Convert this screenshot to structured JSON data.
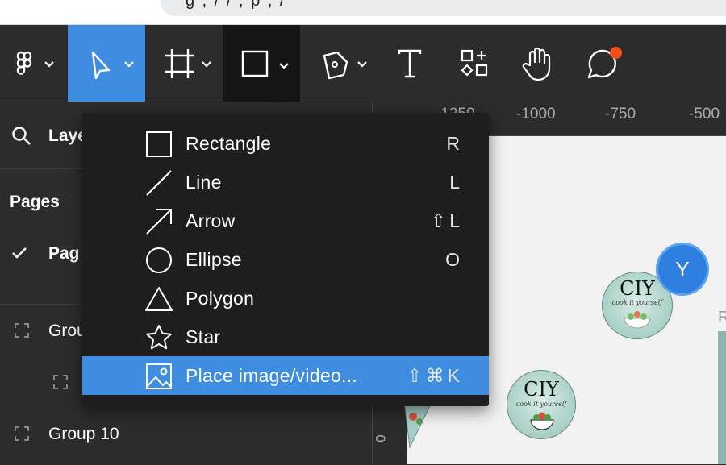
{
  "browser": {
    "url_fragment": "g  ,  /  /  ,   p   ,  /"
  },
  "toolbar": {
    "tools": [
      {
        "name": "main-menu-icon"
      },
      {
        "name": "move-tool-icon"
      },
      {
        "name": "frame-tool-icon"
      },
      {
        "name": "shape-tool-icon"
      },
      {
        "name": "pen-tool-icon"
      },
      {
        "name": "text-tool-icon"
      },
      {
        "name": "resources-icon"
      },
      {
        "name": "hand-tool-icon"
      },
      {
        "name": "comment-tool-icon"
      }
    ],
    "accent": "#3f8de0",
    "notification_color": "#f24e1e"
  },
  "left_panel": {
    "layers_label": "Laye",
    "pages_heading": "Pages",
    "current_page": "Pag",
    "layers": [
      "Grou",
      "",
      "Group 10"
    ]
  },
  "ruler": {
    "ticks": [
      "-1250",
      "-1000",
      "-750",
      "-500"
    ],
    "v_tick": "0"
  },
  "canvas": {
    "logo_text": "CIY",
    "logo_subtext": "cook it yourself",
    "right_edge_text": "R",
    "avatar_initial": "Y",
    "avatar_color": "#2f7fe0"
  },
  "shape_menu": {
    "items": [
      {
        "label": "Rectangle",
        "shortcut": "R",
        "icon": "rectangle-icon"
      },
      {
        "label": "Line",
        "shortcut": "L",
        "icon": "line-icon"
      },
      {
        "label": "Arrow",
        "shortcut": "⇧L",
        "icon": "arrow-icon"
      },
      {
        "label": "Ellipse",
        "shortcut": "O",
        "icon": "ellipse-icon"
      },
      {
        "label": "Polygon",
        "shortcut": "",
        "icon": "polygon-icon"
      },
      {
        "label": "Star",
        "shortcut": "",
        "icon": "star-icon"
      },
      {
        "label": "Place image/video...",
        "shortcut": "⇧⌘K",
        "icon": "image-icon",
        "selected": true
      }
    ]
  }
}
